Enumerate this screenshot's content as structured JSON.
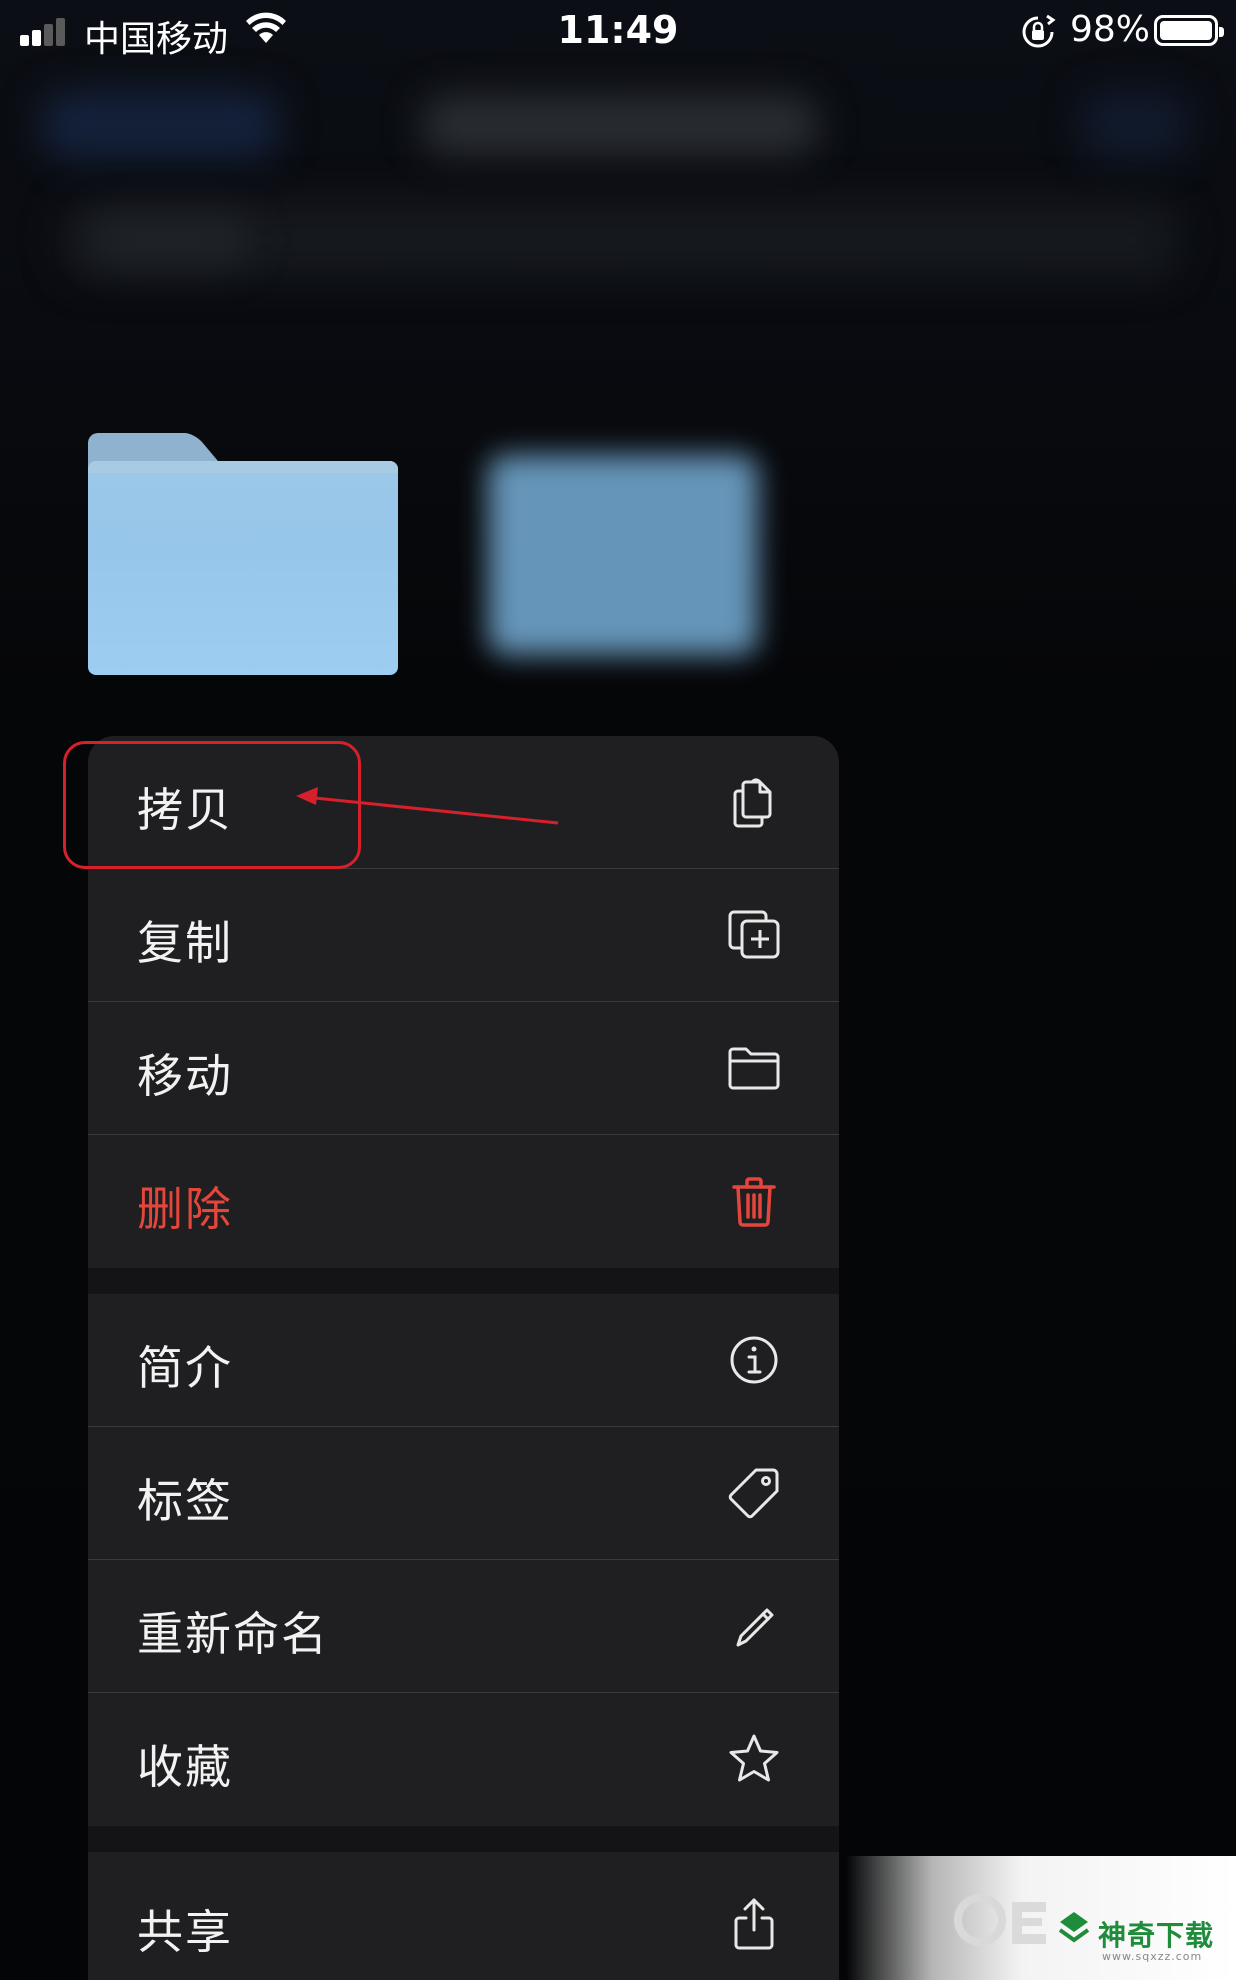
{
  "status_bar": {
    "carrier": "中国移动",
    "time": "11:49",
    "battery_percent": "98%",
    "battery_level": 0.98,
    "signal_bars_active": 2
  },
  "folder": {
    "color": "#9cc8e8",
    "icon": "folder-icon"
  },
  "context_menu": {
    "items": [
      {
        "label": "拷贝",
        "icon": "copy-icon"
      },
      {
        "label": "复制",
        "icon": "duplicate-icon"
      },
      {
        "label": "移动",
        "icon": "folder-outline-icon"
      },
      {
        "label": "删除",
        "icon": "trash-icon",
        "destructive": true,
        "color": "#e5463c"
      },
      {
        "label": "简介",
        "icon": "info-icon"
      },
      {
        "label": "标签",
        "icon": "tag-icon"
      },
      {
        "label": "重新命名",
        "icon": "pencil-icon"
      },
      {
        "label": "收藏",
        "icon": "star-icon"
      },
      {
        "label": "共享",
        "icon": "share-icon"
      }
    ]
  },
  "annotation": {
    "color": "#d6202c"
  },
  "watermark": {
    "brand": "神奇下载",
    "url": "www.sqxzz.com"
  }
}
